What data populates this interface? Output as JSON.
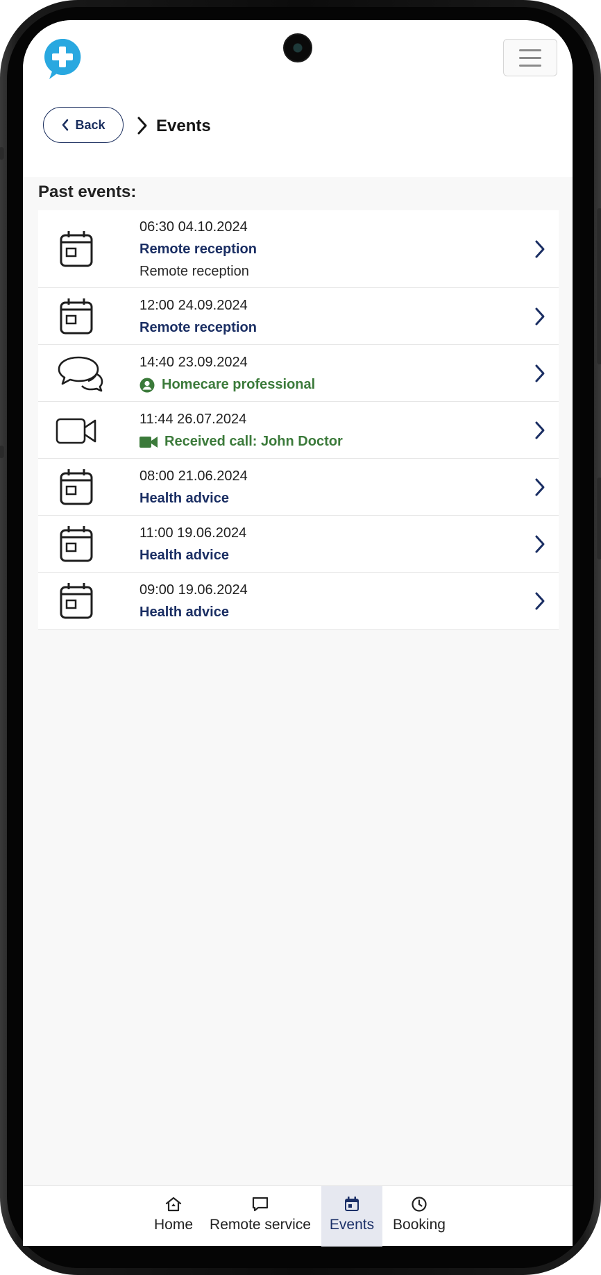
{
  "header": {
    "logo": "plus-chat-logo",
    "menu_icon": "hamburger-icon"
  },
  "breadcrumb": {
    "back_label": "Back",
    "current": "Events"
  },
  "section_title": "Past events:",
  "events": [
    {
      "icon": "calendar-icon",
      "datetime": "06:30 04.10.2024",
      "title": "Remote reception",
      "subtitle": "Remote reception",
      "title_color": "#1a2e63"
    },
    {
      "icon": "calendar-icon",
      "datetime": "12:00 24.09.2024",
      "title": "Remote reception",
      "title_color": "#1a2e63"
    },
    {
      "icon": "chat-bubbles-icon",
      "datetime": "14:40 23.09.2024",
      "title": "Homecare professional",
      "title_icon": "person-circle-icon",
      "title_color": "#3b7a3a"
    },
    {
      "icon": "video-camera-icon",
      "datetime": "11:44 26.07.2024",
      "title": "Received call: John Doctor",
      "title_icon": "video-icon",
      "title_color": "#3b7a3a"
    },
    {
      "icon": "calendar-icon",
      "datetime": "08:00 21.06.2024",
      "title": "Health advice",
      "title_color": "#1a2e63"
    },
    {
      "icon": "calendar-icon",
      "datetime": "11:00 19.06.2024",
      "title": "Health advice",
      "title_color": "#1a2e63"
    },
    {
      "icon": "calendar-icon",
      "datetime": "09:00 19.06.2024",
      "title": "Health advice",
      "title_color": "#1a2e63"
    }
  ],
  "bottom_nav": [
    {
      "label": "Home",
      "icon": "home-icon",
      "active": false
    },
    {
      "label": "Remote service",
      "icon": "chat-icon",
      "active": false
    },
    {
      "label": "Events",
      "icon": "calendar-icon",
      "active": true
    },
    {
      "label": "Booking",
      "icon": "clock-icon",
      "active": false
    }
  ],
  "colors": {
    "accent_navy": "#1a2e63",
    "accent_green": "#3b7a3a",
    "logo_blue": "#29a8e0"
  }
}
